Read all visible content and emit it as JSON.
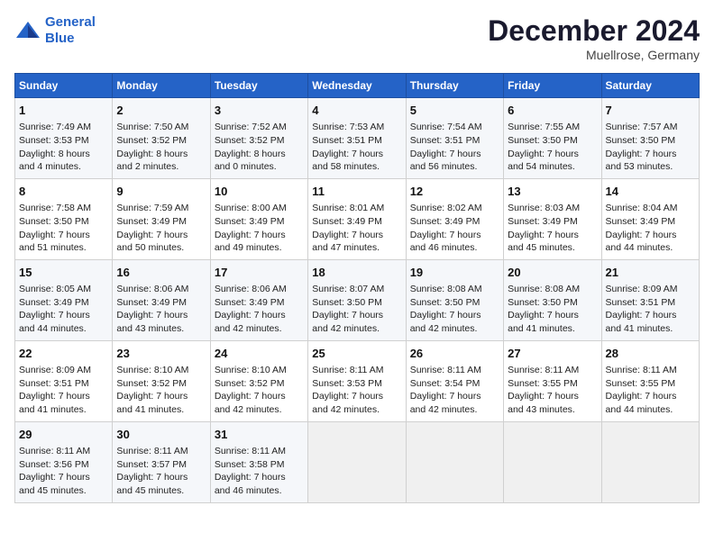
{
  "header": {
    "logo_line1": "General",
    "logo_line2": "Blue",
    "month_title": "December 2024",
    "location": "Muellrose, Germany"
  },
  "weekdays": [
    "Sunday",
    "Monday",
    "Tuesday",
    "Wednesday",
    "Thursday",
    "Friday",
    "Saturday"
  ],
  "weeks": [
    [
      {
        "day": 1,
        "lines": [
          "Sunrise: 7:49 AM",
          "Sunset: 3:53 PM",
          "Daylight: 8 hours",
          "and 4 minutes."
        ]
      },
      {
        "day": 2,
        "lines": [
          "Sunrise: 7:50 AM",
          "Sunset: 3:52 PM",
          "Daylight: 8 hours",
          "and 2 minutes."
        ]
      },
      {
        "day": 3,
        "lines": [
          "Sunrise: 7:52 AM",
          "Sunset: 3:52 PM",
          "Daylight: 8 hours",
          "and 0 minutes."
        ]
      },
      {
        "day": 4,
        "lines": [
          "Sunrise: 7:53 AM",
          "Sunset: 3:51 PM",
          "Daylight: 7 hours",
          "and 58 minutes."
        ]
      },
      {
        "day": 5,
        "lines": [
          "Sunrise: 7:54 AM",
          "Sunset: 3:51 PM",
          "Daylight: 7 hours",
          "and 56 minutes."
        ]
      },
      {
        "day": 6,
        "lines": [
          "Sunrise: 7:55 AM",
          "Sunset: 3:50 PM",
          "Daylight: 7 hours",
          "and 54 minutes."
        ]
      },
      {
        "day": 7,
        "lines": [
          "Sunrise: 7:57 AM",
          "Sunset: 3:50 PM",
          "Daylight: 7 hours",
          "and 53 minutes."
        ]
      }
    ],
    [
      {
        "day": 8,
        "lines": [
          "Sunrise: 7:58 AM",
          "Sunset: 3:50 PM",
          "Daylight: 7 hours",
          "and 51 minutes."
        ]
      },
      {
        "day": 9,
        "lines": [
          "Sunrise: 7:59 AM",
          "Sunset: 3:49 PM",
          "Daylight: 7 hours",
          "and 50 minutes."
        ]
      },
      {
        "day": 10,
        "lines": [
          "Sunrise: 8:00 AM",
          "Sunset: 3:49 PM",
          "Daylight: 7 hours",
          "and 49 minutes."
        ]
      },
      {
        "day": 11,
        "lines": [
          "Sunrise: 8:01 AM",
          "Sunset: 3:49 PM",
          "Daylight: 7 hours",
          "and 47 minutes."
        ]
      },
      {
        "day": 12,
        "lines": [
          "Sunrise: 8:02 AM",
          "Sunset: 3:49 PM",
          "Daylight: 7 hours",
          "and 46 minutes."
        ]
      },
      {
        "day": 13,
        "lines": [
          "Sunrise: 8:03 AM",
          "Sunset: 3:49 PM",
          "Daylight: 7 hours",
          "and 45 minutes."
        ]
      },
      {
        "day": 14,
        "lines": [
          "Sunrise: 8:04 AM",
          "Sunset: 3:49 PM",
          "Daylight: 7 hours",
          "and 44 minutes."
        ]
      }
    ],
    [
      {
        "day": 15,
        "lines": [
          "Sunrise: 8:05 AM",
          "Sunset: 3:49 PM",
          "Daylight: 7 hours",
          "and 44 minutes."
        ]
      },
      {
        "day": 16,
        "lines": [
          "Sunrise: 8:06 AM",
          "Sunset: 3:49 PM",
          "Daylight: 7 hours",
          "and 43 minutes."
        ]
      },
      {
        "day": 17,
        "lines": [
          "Sunrise: 8:06 AM",
          "Sunset: 3:49 PM",
          "Daylight: 7 hours",
          "and 42 minutes."
        ]
      },
      {
        "day": 18,
        "lines": [
          "Sunrise: 8:07 AM",
          "Sunset: 3:50 PM",
          "Daylight: 7 hours",
          "and 42 minutes."
        ]
      },
      {
        "day": 19,
        "lines": [
          "Sunrise: 8:08 AM",
          "Sunset: 3:50 PM",
          "Daylight: 7 hours",
          "and 42 minutes."
        ]
      },
      {
        "day": 20,
        "lines": [
          "Sunrise: 8:08 AM",
          "Sunset: 3:50 PM",
          "Daylight: 7 hours",
          "and 41 minutes."
        ]
      },
      {
        "day": 21,
        "lines": [
          "Sunrise: 8:09 AM",
          "Sunset: 3:51 PM",
          "Daylight: 7 hours",
          "and 41 minutes."
        ]
      }
    ],
    [
      {
        "day": 22,
        "lines": [
          "Sunrise: 8:09 AM",
          "Sunset: 3:51 PM",
          "Daylight: 7 hours",
          "and 41 minutes."
        ]
      },
      {
        "day": 23,
        "lines": [
          "Sunrise: 8:10 AM",
          "Sunset: 3:52 PM",
          "Daylight: 7 hours",
          "and 41 minutes."
        ]
      },
      {
        "day": 24,
        "lines": [
          "Sunrise: 8:10 AM",
          "Sunset: 3:52 PM",
          "Daylight: 7 hours",
          "and 42 minutes."
        ]
      },
      {
        "day": 25,
        "lines": [
          "Sunrise: 8:11 AM",
          "Sunset: 3:53 PM",
          "Daylight: 7 hours",
          "and 42 minutes."
        ]
      },
      {
        "day": 26,
        "lines": [
          "Sunrise: 8:11 AM",
          "Sunset: 3:54 PM",
          "Daylight: 7 hours",
          "and 42 minutes."
        ]
      },
      {
        "day": 27,
        "lines": [
          "Sunrise: 8:11 AM",
          "Sunset: 3:55 PM",
          "Daylight: 7 hours",
          "and 43 minutes."
        ]
      },
      {
        "day": 28,
        "lines": [
          "Sunrise: 8:11 AM",
          "Sunset: 3:55 PM",
          "Daylight: 7 hours",
          "and 44 minutes."
        ]
      }
    ],
    [
      {
        "day": 29,
        "lines": [
          "Sunrise: 8:11 AM",
          "Sunset: 3:56 PM",
          "Daylight: 7 hours",
          "and 45 minutes."
        ]
      },
      {
        "day": 30,
        "lines": [
          "Sunrise: 8:11 AM",
          "Sunset: 3:57 PM",
          "Daylight: 7 hours",
          "and 45 minutes."
        ]
      },
      {
        "day": 31,
        "lines": [
          "Sunrise: 8:11 AM",
          "Sunset: 3:58 PM",
          "Daylight: 7 hours",
          "and 46 minutes."
        ]
      },
      null,
      null,
      null,
      null
    ]
  ]
}
